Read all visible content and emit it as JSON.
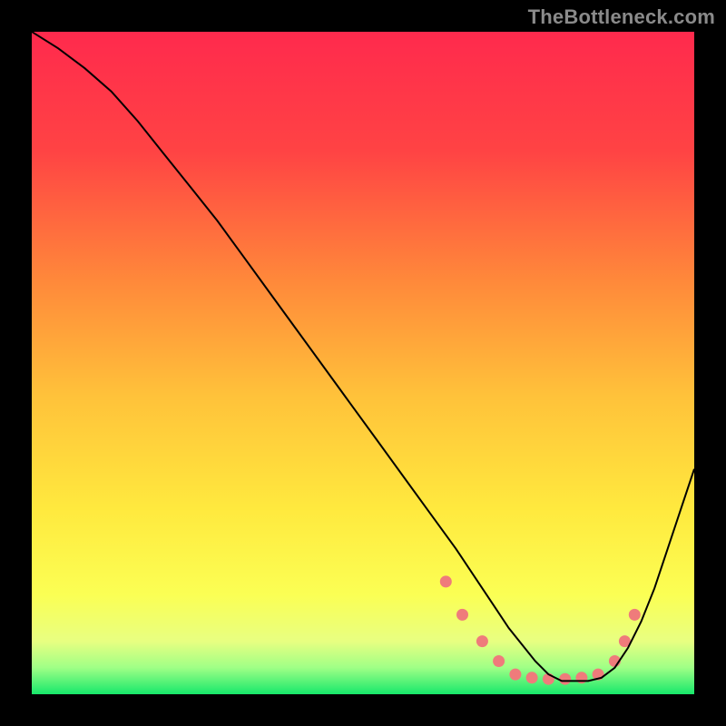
{
  "watermark": "TheBottleneck.com",
  "chart_data": {
    "type": "line",
    "title": "",
    "xlabel": "",
    "ylabel": "",
    "xlim": [
      0,
      100
    ],
    "ylim": [
      0,
      100
    ],
    "grid": false,
    "legend": false,
    "background_gradient_stops": [
      {
        "offset": 0,
        "color": "#ff2a4d"
      },
      {
        "offset": 18,
        "color": "#ff4344"
      },
      {
        "offset": 38,
        "color": "#ff8a3a"
      },
      {
        "offset": 55,
        "color": "#ffc23a"
      },
      {
        "offset": 72,
        "color": "#ffe93e"
      },
      {
        "offset": 85,
        "color": "#fbff54"
      },
      {
        "offset": 92,
        "color": "#e8ff81"
      },
      {
        "offset": 96,
        "color": "#9fff86"
      },
      {
        "offset": 100,
        "color": "#17e86b"
      }
    ],
    "series": [
      {
        "name": "curve",
        "color": "#000000",
        "stroke_width": 2,
        "x": [
          0,
          4,
          8,
          12,
          16,
          20,
          24,
          28,
          32,
          36,
          40,
          44,
          48,
          52,
          56,
          60,
          64,
          66,
          68,
          70,
          72,
          74,
          76,
          78,
          80,
          82,
          84,
          86,
          88,
          90,
          92,
          94,
          96,
          98,
          100
        ],
        "y": [
          100,
          97.5,
          94.5,
          91,
          86.5,
          81.5,
          76.5,
          71.5,
          66,
          60.5,
          55,
          49.5,
          44,
          38.5,
          33,
          27.5,
          22,
          19,
          16,
          13,
          10,
          7.5,
          5,
          3,
          2,
          2,
          2,
          2.5,
          4,
          7,
          11,
          16,
          22,
          28,
          34
        ]
      },
      {
        "name": "highlight-dots",
        "color": "#ef7b7b",
        "marker_radius": 6.5,
        "x": [
          62.5,
          65.0,
          68.0,
          70.5,
          73.0,
          75.5,
          78.0,
          80.5,
          83.0,
          85.5,
          88.0,
          89.5,
          91.0
        ],
        "y": [
          17.0,
          12.0,
          8.0,
          5.0,
          3.0,
          2.5,
          2.3,
          2.3,
          2.5,
          3.0,
          5.0,
          8.0,
          12.0
        ]
      }
    ]
  }
}
